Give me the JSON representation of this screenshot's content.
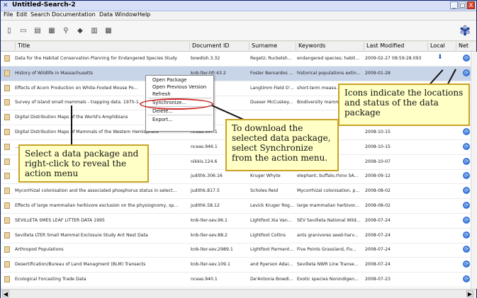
{
  "window": {
    "title": "Untitled-Search-2",
    "min": "_",
    "max": "□",
    "close": "X"
  },
  "menu": [
    "File",
    "Edit",
    "Search",
    "Documentation",
    "Data",
    "Window",
    "Help"
  ],
  "toolbar_icons": [
    "open-icon",
    "save-icon",
    "db-icon",
    "copy-icon",
    "search-icon",
    "diamond-icon",
    "print-icon",
    "grid-icon"
  ],
  "logo_icon": "butterfly-icon",
  "columns": [
    "Title",
    "Document ID",
    "Surname",
    "Keywords",
    "Last Modified",
    "Local",
    "Net"
  ],
  "rows": [
    {
      "title": "Data for the Habitat Conservation Planning for Endangered Species Study",
      "doc": "bowdish.3.32",
      "surname": "Regetz; Ruckelsh...",
      "kw": "endangered species; habit...",
      "mod": "2009-02-27 08:59:28.093",
      "local": true
    },
    {
      "title": "History of Wildlife in Massachusetts",
      "doc": "knb-lter-hfr.43.2",
      "surname": "Foster Bernardos ...",
      "kw": "historical populations extin...",
      "mod": "2009-01-28",
      "local": false
    },
    {
      "title": "Effects of Acorn Production on White-Footed Mouse Po...",
      "doc": "...r.30.3",
      "surname": "Langtimm Field O'...",
      "kw": "short-term measu...",
      "mod": "",
      "local": false
    },
    {
      "title": "Survey of island small mammals - trapping data. 1975-1...",
      "doc": "...r.1",
      "surname": "Dueser McCuskey...",
      "kw": "Biodiversity mamm...",
      "mod": "",
      "local": false
    },
    {
      "title": "Digital Distribution Maps of the World's Amphibians",
      "doc": "...1",
      "surname": "",
      "kw": "",
      "mod": "",
      "local": false
    },
    {
      "title": "Digital Distribution Maps of Mammals of the Western Hemisphere",
      "doc": "nceas.947.1",
      "surname": "",
      "kw": "",
      "mod": "2008-10-15",
      "local": false
    },
    {
      "title": "...re",
      "doc": "nceas.946.1",
      "surname": "",
      "kw": "",
      "mod": "2008-10-15",
      "local": false
    },
    {
      "title": "",
      "doc": "nikkis.124.6",
      "surname": "",
      "kw": "...ode, South ...",
      "mod": "2008-10-07",
      "local": false
    },
    {
      "title": "",
      "doc": "judithk.306.16",
      "surname": "Kruger Whyte",
      "kw": "elephant, buffalo,rhino SA...",
      "mod": "2008-09-12",
      "local": false
    },
    {
      "title": "Mycorrhizal colonisation and the associated phosphorus status in select...",
      "doc": "judithk.817.5",
      "surname": "Scholes Reid",
      "kw": "Mycorrhizal colonisation, p...",
      "mod": "2008-08-02",
      "local": false
    },
    {
      "title": "Effects of large mammalian herbivore exclusion on the physiognomy, sp...",
      "doc": "judithk.58.12",
      "surname": "Levick Kruger Rog...",
      "kw": "large mammalian herbivor...",
      "mod": "2008-08-02",
      "local": false
    },
    {
      "title": "SEVILLETA SMES LEAF LITTER DATA 1995",
      "doc": "knb-lter-sev.96.1",
      "surname": "Lightfoot Xia Van...",
      "kw": "SEV Sevilleta National Wild...",
      "mod": "2008-07-24",
      "local": false
    },
    {
      "title": "Sevilleta LTER Small Mammal Exclosure Study Ant Nest Data",
      "doc": "knb-lter-sev.88.2",
      "surname": "Lightfoot Collins",
      "kw": "ants granivores seed-harv...",
      "mod": "2008-07-24",
      "local": false
    },
    {
      "title": "Arthropod Populations",
      "doc": "knb-lter-sev.2989.1",
      "surname": "Lightfoot Parment...",
      "kw": "Five Points Grassland, Fiv...",
      "mod": "2008-07-24",
      "local": false
    },
    {
      "title": "Desertification/Bureau of Land Managment (BLM) Transects",
      "doc": "knb-lter-sev.109.1",
      "surname": "and Ryerson Adai...",
      "kw": "Sevilleta NWR Line Transe...",
      "mod": "2008-07-24",
      "local": false
    },
    {
      "title": "Ecological Forcasting Trade Data",
      "doc": "nceas.940.1",
      "surname": "De'Antonia Bowdi...",
      "kw": "Exotic species Nonindigen...",
      "mod": "2008-07-23",
      "local": false
    }
  ],
  "context_menu": [
    "Open Package",
    "Open Previous Version",
    "Refresh",
    "Synchronize...",
    "Delete...",
    "Export..."
  ],
  "callouts": {
    "icons": "Icons indicate the locations and status of the data package",
    "select": "Select a data package and right-click to reveal the action menu",
    "sync": "To download the selected data package, select Synchronize from the action menu."
  },
  "colors": {
    "accent": "#d02a2a",
    "callout_bg": "#ffffc6",
    "selection": "#c8d4e8"
  }
}
